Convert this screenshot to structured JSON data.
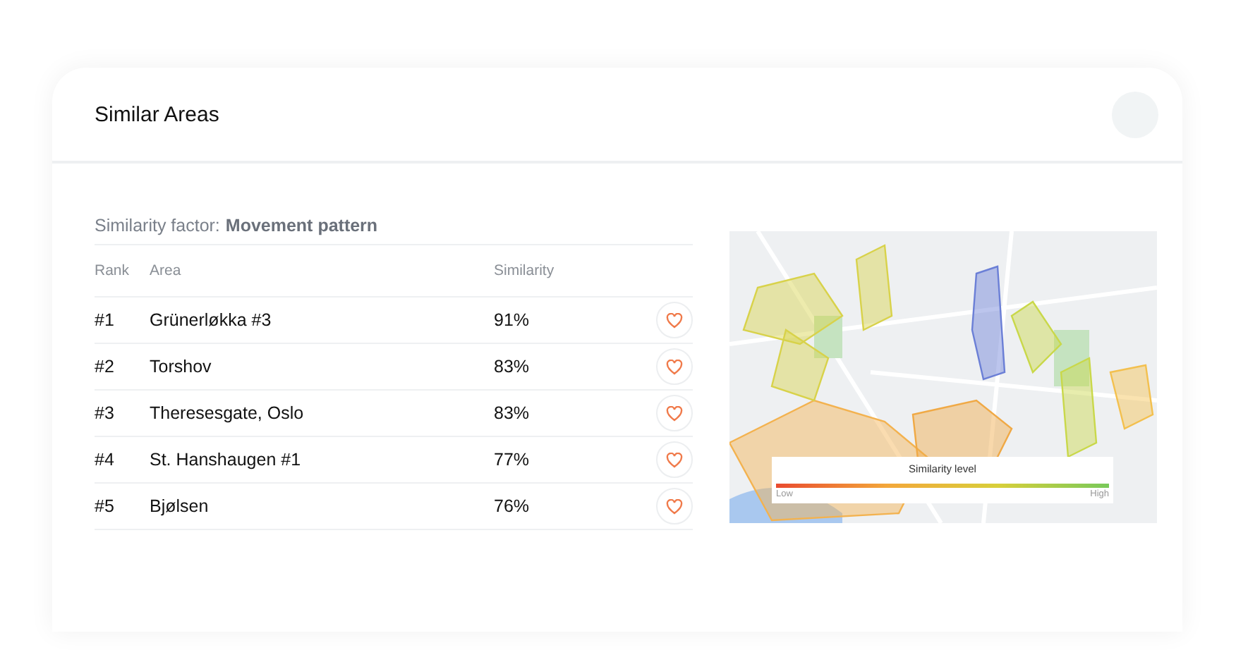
{
  "title": "Similar Areas",
  "factor": {
    "label": "Similarity factor:",
    "value": "Movement pattern"
  },
  "table": {
    "columns": [
      "Rank",
      "Area",
      "Similarity"
    ],
    "rows": [
      {
        "rank": "#1",
        "area": "Grünerløkka #3",
        "similarity": "91%"
      },
      {
        "rank": "#2",
        "area": "Torshov",
        "similarity": "83%"
      },
      {
        "rank": "#3",
        "area": "Theresesgate, Oslo",
        "similarity": "83%"
      },
      {
        "rank": "#4",
        "area": "St. Hanshaugen #1",
        "similarity": "77%"
      },
      {
        "rank": "#5",
        "area": "Bjølsen",
        "similarity": "76%"
      }
    ]
  },
  "legend": {
    "title": "Similarity level",
    "low": "Low",
    "high": "High"
  }
}
